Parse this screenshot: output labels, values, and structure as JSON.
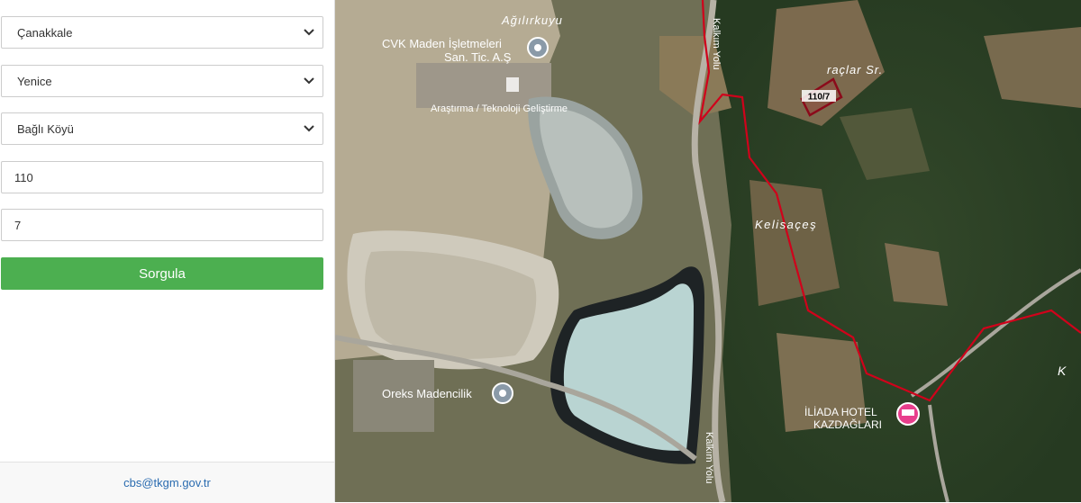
{
  "form": {
    "province": {
      "selected": "Çanakkale"
    },
    "district": {
      "selected": "Yenice"
    },
    "neighborhood": {
      "selected": "Bağlı Köyü"
    },
    "block_no": {
      "value": "110"
    },
    "parcel_no": {
      "value": "7"
    },
    "query_button_label": "Sorgula"
  },
  "footer": {
    "email": "cbs@tkgm.gov.tr"
  },
  "map": {
    "basemap": "satellite",
    "parcel_label": "110/7",
    "boundary_color": "#d0021b",
    "labels": {
      "village_top": "Ağılırkuyu",
      "poi_cvk_line1": "CVK Maden İşletmeleri",
      "poi_cvk_line2": "San. Tic. A.Ş",
      "poi_research": "Araştırma / Teknoloji Geliştirme",
      "poi_oreks": "Oreks Madencilik",
      "road_top": "Kalkım Yolu",
      "road_bottom": "Kalkım Yolu",
      "area_aralar": "raçlar Sr.",
      "area_kelisaces": "Kelisaçeş",
      "hotel_line1": "İLİADA HOTEL",
      "hotel_line2": "KAZDAĞLARI",
      "edge_letter": "K"
    }
  }
}
